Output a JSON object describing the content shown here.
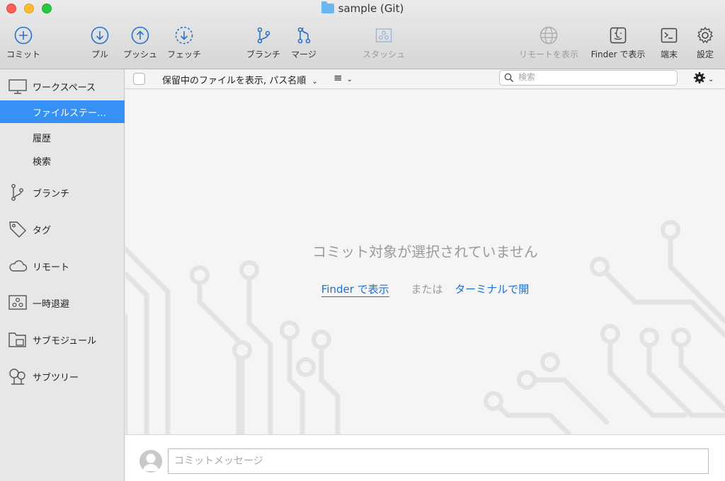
{
  "window": {
    "title": "sample (Git)"
  },
  "toolbar": {
    "commit": {
      "label": "コミット",
      "icon": "plus-circle-icon"
    },
    "pull": {
      "label": "プル",
      "icon": "arrow-down-circle-icon"
    },
    "push": {
      "label": "プッシュ",
      "icon": "arrow-up-circle-icon"
    },
    "fetch": {
      "label": "フェッチ",
      "icon": "fetch-dashed-circle-icon"
    },
    "branch": {
      "label": "ブランチ",
      "icon": "branch-icon"
    },
    "merge": {
      "label": "マージ",
      "icon": "merge-icon"
    },
    "stash": {
      "label": "スタッシュ",
      "icon": "stash-icon",
      "disabled": true
    },
    "show_remote": {
      "label": "リモートを表示",
      "icon": "globe-icon",
      "disabled": true
    },
    "finder": {
      "label": "Finder で表示",
      "icon": "finder-icon"
    },
    "terminal": {
      "label": "端末",
      "icon": "terminal-icon"
    },
    "settings": {
      "label": "設定",
      "icon": "gear-icon"
    }
  },
  "sidebar": {
    "workspace": "ワークスペース",
    "file_status": "ファイルステー…",
    "history": "履歴",
    "search": "検索",
    "branches": "ブランチ",
    "tags": "タグ",
    "remotes": "リモート",
    "stashes": "一時退避",
    "submodules": "サブモジュール",
    "subtrees": "サブツリー"
  },
  "filterbar": {
    "filter_label": "保留中のファイルを表示, パス名順",
    "search_placeholder": "検索"
  },
  "empty_state": {
    "message": "コミット対象が選択されていません",
    "finder_link": "Finder で表示",
    "or": "または",
    "terminal_link": "ターミナルで開"
  },
  "commit": {
    "placeholder": "コミットメッセージ"
  },
  "colors": {
    "accent": "#3790f3",
    "link": "#1f6fd1",
    "icon": "#2a72c9"
  }
}
